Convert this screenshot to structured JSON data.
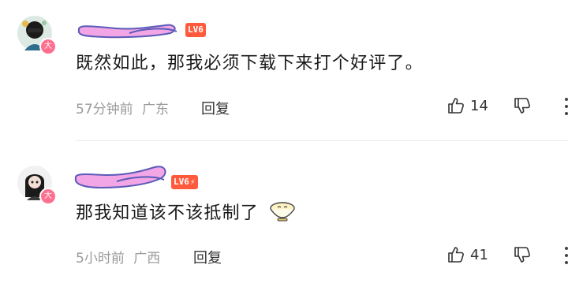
{
  "comments": [
    {
      "level_badge": "LV6",
      "text": "既然如此，那我必须下载下来打个好评了。",
      "time": "57分钟前",
      "location": "广东",
      "reply_label": "回复",
      "likes": "14",
      "avatar_badge": "大"
    },
    {
      "level_badge": "LV6",
      "text": "那我知道该不该抵制了",
      "time": "5小时前",
      "location": "广西",
      "reply_label": "回复",
      "likes": "41",
      "avatar_badge": "大"
    }
  ],
  "colors": {
    "scribble": "#f2a6e6",
    "level": "#ff5a3c",
    "meta": "#9a9a9a",
    "badge": "#ff6f8e"
  },
  "icons": [
    "thumbs-up-icon",
    "thumbs-down-icon",
    "more-icon",
    "bowl-emoji-icon"
  ]
}
